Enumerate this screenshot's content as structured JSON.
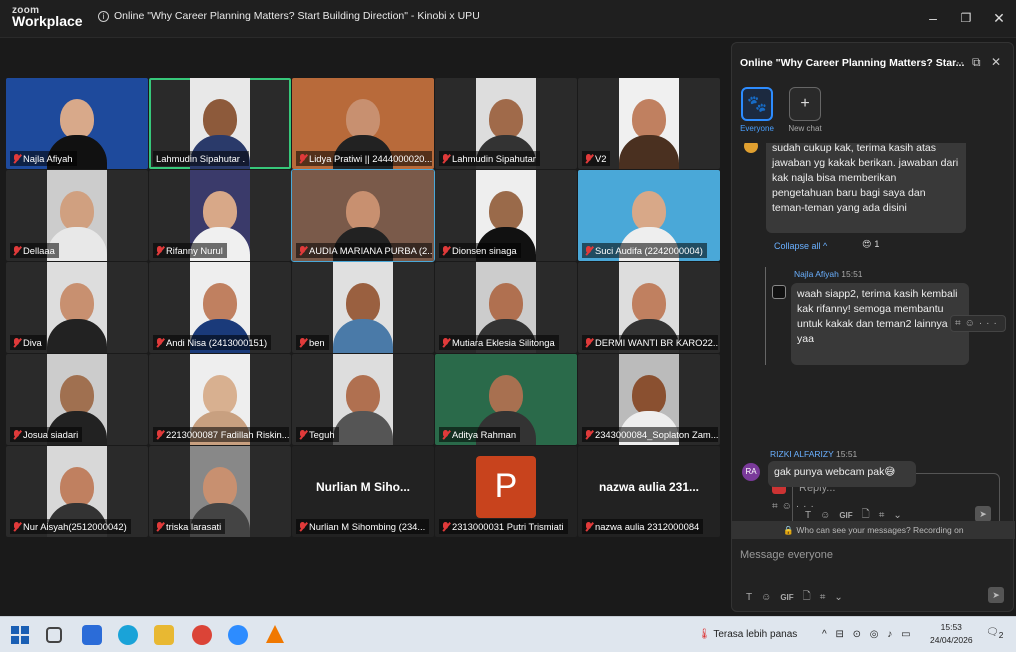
{
  "app": {
    "brand_top": "zoom",
    "brand_bottom": "Workplace"
  },
  "meeting_title": "Online \"Why Career Planning Matters? Start Building Direction\" - Kinobi x UPU",
  "window_controls": {
    "minimize": "–",
    "maximize": "❐",
    "close": "✕"
  },
  "tiles": [
    {
      "name": "Najla Afiyah",
      "muted": true,
      "skin": "#d8a98a",
      "bg": "#1e4a9c",
      "shirt": "#111"
    },
    {
      "name": "Lahmudin Sipahutar .",
      "muted": false,
      "skin": "#8d5a3b",
      "bg": "#e8e8e8",
      "shirt": "#2a3a6a",
      "active": true
    },
    {
      "name": "Lidya Pratiwi || 2444000020...",
      "muted": true,
      "skin": "#c89070",
      "bg": "#b86a3a",
      "shirt": "#222"
    },
    {
      "name": "Lahmudin Sipahutar",
      "muted": true,
      "skin": "#a06a4a",
      "bg": "#ddd",
      "shirt": "#333"
    },
    {
      "name": "V2",
      "muted": true,
      "skin": "#c08060",
      "bg": "#f0f0f0",
      "shirt": "#4a3020"
    },
    {
      "name": "Dellaaa",
      "muted": true,
      "skin": "#d0a080",
      "bg": "#ccc",
      "shirt": "#e8e8e8"
    },
    {
      "name": "Rifanny Nurul",
      "muted": true,
      "skin": "#d8a888",
      "bg": "#3a3a6a",
      "shirt": "#f0f0f0"
    },
    {
      "name": "AUDIA MARIANA PURBA (2...",
      "muted": true,
      "skin": "#c89070",
      "bg": "#7a5a4a",
      "shirt": "#222",
      "active2": true
    },
    {
      "name": "Dionsen sinaga",
      "muted": true,
      "skin": "#9a6a4a",
      "bg": "#eee",
      "shirt": "#111"
    },
    {
      "name": "Suci Audifa (2242000004)",
      "muted": true,
      "skin": "#d8a888",
      "bg": "#4aa8d8",
      "shirt": "#eee"
    },
    {
      "name": "Diva",
      "muted": true,
      "skin": "#c89070",
      "bg": "#ddd",
      "shirt": "#222"
    },
    {
      "name": "Andi Nisa (2413000151)",
      "muted": true,
      "skin": "#c08060",
      "bg": "#eee",
      "shirt": "#1a3a7a"
    },
    {
      "name": "ben",
      "muted": true,
      "skin": "#9a6040",
      "bg": "#e0e0e0",
      "shirt": "#4a7aa8"
    },
    {
      "name": "Mutiara Eklesia Silitonga",
      "muted": true,
      "skin": "#b07050",
      "bg": "#ccc",
      "shirt": "#333"
    },
    {
      "name": "DERMI WANTI BR KARO22...",
      "muted": true,
      "skin": "#c08060",
      "bg": "#ddd",
      "shirt": "#333"
    },
    {
      "name": "Josua siadari",
      "muted": true,
      "skin": "#a07050",
      "bg": "#ccc",
      "shirt": "#222"
    },
    {
      "name": "2213000087 Fadillah Riskin...",
      "muted": true,
      "skin": "#d8b090",
      "bg": "#eee",
      "shirt": "#c8a080"
    },
    {
      "name": "Teguh",
      "muted": true,
      "skin": "#b07050",
      "bg": "#ddd",
      "shirt": "#555"
    },
    {
      "name": "Aditya Rahman",
      "muted": true,
      "skin": "#a87050",
      "bg": "#2a6a4a",
      "shirt": "#333"
    },
    {
      "name": "2343000084_Soplaton Zam...",
      "muted": true,
      "skin": "#8a5030",
      "bg": "#bbb",
      "shirt": "#eee"
    },
    {
      "name": "Nur Aisyah(2512000042)",
      "muted": true,
      "skin": "#c08060",
      "bg": "#d8d8d8",
      "shirt": "#333"
    },
    {
      "name": "triska larasati",
      "muted": true,
      "skin": "#c89070",
      "bg": "#888",
      "shirt": "#444"
    },
    {
      "name": "Nurlian M Sihombing (234...",
      "muted": true,
      "bigname": "Nurlian M Siho..."
    },
    {
      "name": "2313000031 Putri Trismiati",
      "muted": true,
      "letter": "P"
    },
    {
      "name": "nazwa aulia 2312000084",
      "muted": true,
      "bigname": "nazwa aulia 231..."
    }
  ],
  "panel": {
    "title": "Online \"Why Career Planning Matters? Star...",
    "more": "···",
    "popout": "⧉",
    "close": "✕",
    "channels": [
      {
        "label": "Everyone",
        "icon": "🐾"
      },
      {
        "label": "New chat",
        "icon": "+"
      }
    ],
    "messages": {
      "m1": "sudah cukup kak, terima kasih atas jawaban yg kakak berikan. jawaban dari kak najla bisa memberikan pengetahuan baru bagi saya dan teman-teman yang ada disini",
      "collapse": "Collapse all ^",
      "reaction_emoji": "😍",
      "reaction_count": "1",
      "reply_sender": "Najla Afiyah",
      "reply_time": "15:51",
      "reply_text": "waah siapp2, terima kasih kembali kak rifanny! semoga membantu untuk kakak dan teman2 lainnya yaa",
      "reply_placeholder": "Reply...",
      "sender2": "RIZKI ALFARIZY",
      "time2": "15:51",
      "avatar2": "RA",
      "m2": "gak punya webcam pak😅"
    },
    "tools": [
      "T",
      "☺",
      "GIF",
      "🗋",
      "⌗",
      "⌄"
    ],
    "privacy": "Who can see your messages? Recording on",
    "input_placeholder": "Message everyone",
    "send_icon": "➤"
  },
  "taskbar": {
    "weather": "Terasa lebih panas",
    "tray": "^ ⊟ ⊙ ◎ ♪ ▭",
    "time": "15:53",
    "date": "24/04/2026",
    "notif_count": "2"
  }
}
